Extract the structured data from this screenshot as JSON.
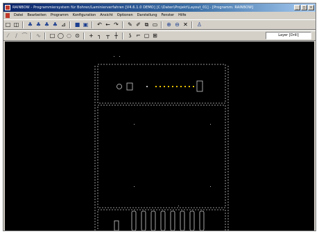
{
  "window": {
    "title": "RAINBOW - Programmiersystem für Bohren/Laminierverfahren [V4.6.1.0 DEMO] [C:\\Daten\\Projekt\\Layout_01] - [Programm: RAINBOW]",
    "buttons": {
      "minimize": "_",
      "maximize": "□",
      "close": "×"
    }
  },
  "menubar": {
    "items": [
      "Datei",
      "Bearbeiten",
      "Programm",
      "Konfiguration",
      "Ansicht",
      "Optionen",
      "Darstellung",
      "Fenster",
      "Hilfe"
    ]
  },
  "toolbar1": {
    "icons": [
      "new-icon",
      "open-icon",
      "tool-1-icon",
      "tool-2-icon",
      "tool-3-icon",
      "tool-4-icon",
      "tool-5-icon",
      "save-icon",
      "save-as-icon",
      "undo-icon",
      "arrow-left-icon",
      "redo-icon",
      "draw-icon",
      "edit-icon",
      "copy-icon",
      "screen-icon",
      "zoom-in-icon",
      "zoom-out-icon",
      "close-view-icon",
      "person-icon"
    ]
  },
  "toolbar2": {
    "icons": [
      "line-icon",
      "polyline-icon",
      "arc-icon",
      "curve-icon",
      "rect-icon",
      "circle-icon",
      "ellipse-icon",
      "drill-icon",
      "cross-icon",
      "corner-icon",
      "tee-icon",
      "plus-icon",
      "hook-icon",
      "dimension-icon",
      "square-icon",
      "grid-icon"
    ],
    "layer_value": "Layer [Drill]"
  },
  "colors": {
    "title_start": "#0a246a",
    "title_end": "#a6caf0",
    "canvas": "#000000",
    "chrome": "#d4d0c8",
    "outline": "#c8c8c8",
    "pad": "#f2c500"
  }
}
